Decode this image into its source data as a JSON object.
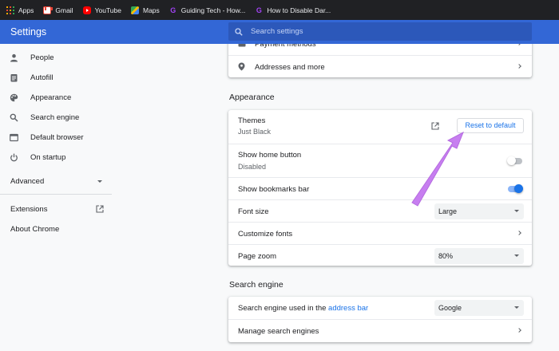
{
  "bookmarks": [
    {
      "label": "Apps",
      "icon": "apps-icon"
    },
    {
      "label": "Gmail",
      "icon": "gmail-icon"
    },
    {
      "label": "YouTube",
      "icon": "youtube-icon"
    },
    {
      "label": "Maps",
      "icon": "maps-icon"
    },
    {
      "label": "Guiding Tech - How...",
      "icon": "guiding-tech-icon"
    },
    {
      "label": "How to Disable Dar...",
      "icon": "guiding-tech-icon"
    }
  ],
  "header": {
    "title": "Settings",
    "search_placeholder": "Search settings"
  },
  "sidebar": {
    "items": [
      {
        "label": "People",
        "icon": "person-icon"
      },
      {
        "label": "Autofill",
        "icon": "clipboard-icon"
      },
      {
        "label": "Appearance",
        "icon": "palette-icon"
      },
      {
        "label": "Search engine",
        "icon": "search-icon"
      },
      {
        "label": "Default browser",
        "icon": "browser-icon"
      },
      {
        "label": "On startup",
        "icon": "power-icon"
      }
    ],
    "advanced": "Advanced",
    "extensions": "Extensions",
    "about": "About Chrome"
  },
  "autofill_card": {
    "payment_methods": "Payment methods",
    "addresses": "Addresses and more"
  },
  "appearance": {
    "title": "Appearance",
    "themes_label": "Themes",
    "themes_value": "Just Black",
    "reset_button": "Reset to default",
    "home_button_label": "Show home button",
    "home_button_value": "Disabled",
    "home_button_enabled": false,
    "bookmarks_bar_label": "Show bookmarks bar",
    "bookmarks_bar_enabled": true,
    "font_size_label": "Font size",
    "font_size_value": "Large",
    "customize_fonts_label": "Customize fonts",
    "page_zoom_label": "Page zoom",
    "page_zoom_value": "80%"
  },
  "search_engine": {
    "title": "Search engine",
    "used_label_prefix": "Search engine used in the ",
    "used_label_link": "address bar",
    "used_value": "Google",
    "manage_label": "Manage search engines"
  },
  "colors": {
    "header": "#3367d6",
    "accent": "#1a73e8",
    "annotation_arrow": "#c77ef0"
  }
}
